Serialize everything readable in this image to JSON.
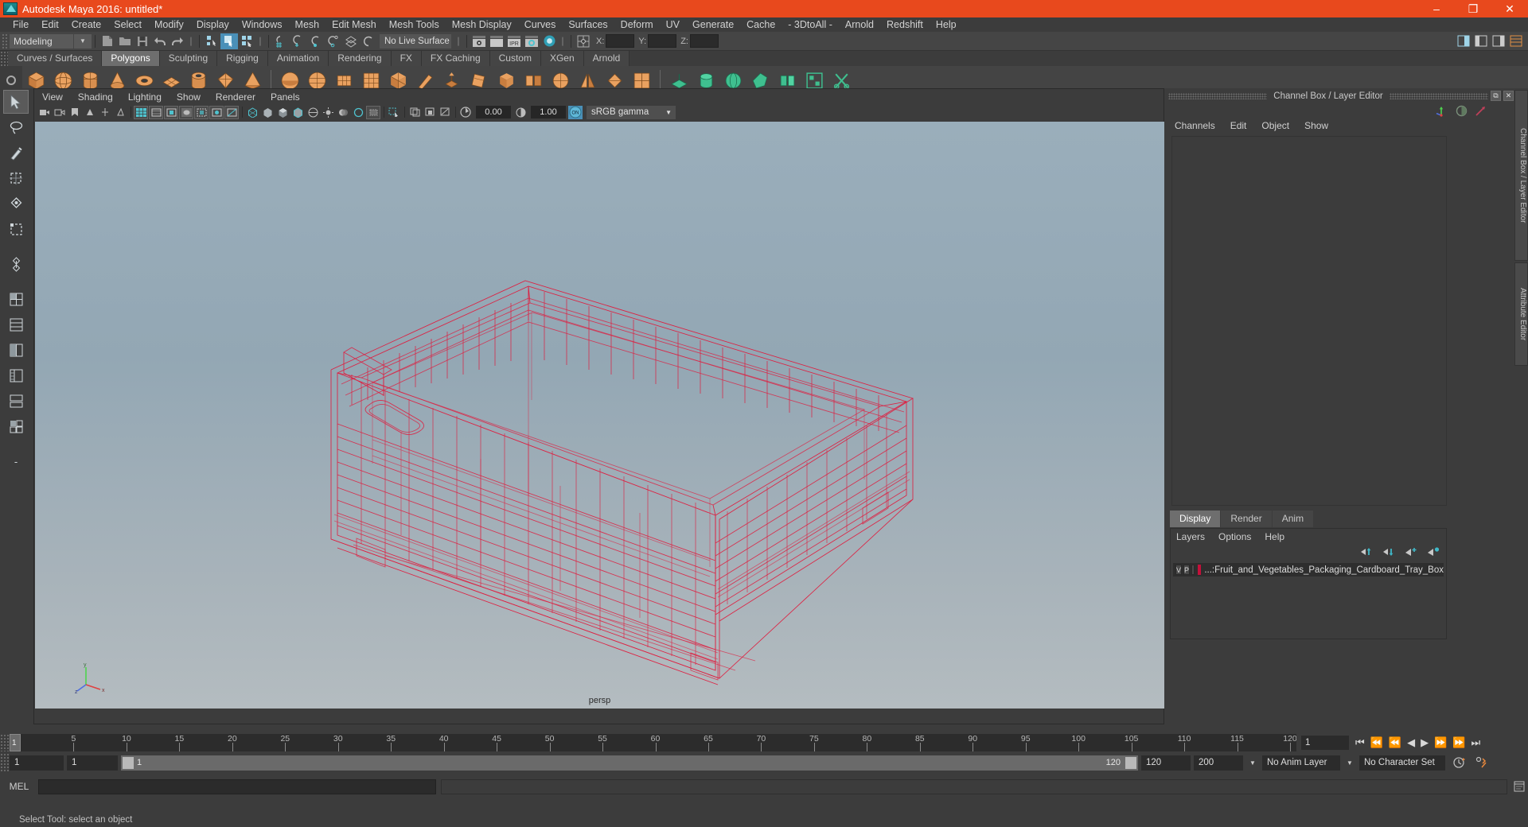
{
  "titlebar": {
    "title": "Autodesk Maya 2016: untitled*",
    "logo_icon": "maya-logo-icon",
    "minimize": "–",
    "maximize": "❐",
    "close": "✕"
  },
  "menubar": {
    "items": [
      "File",
      "Edit",
      "Create",
      "Select",
      "Modify",
      "Display",
      "Windows",
      "Mesh",
      "Edit Mesh",
      "Mesh Tools",
      "Mesh Display",
      "Curves",
      "Surfaces",
      "Deform",
      "UV",
      "Generate",
      "Cache",
      "- 3DtoAll -",
      "Arnold",
      "Redshift",
      "Help"
    ]
  },
  "statusline": {
    "menu_set": "Modeling",
    "live_surface": "No Live Surface",
    "coord_x_label": "X:",
    "coord_y_label": "Y:",
    "coord_z_label": "Z:",
    "coord_x_value": "",
    "coord_y_value": "",
    "coord_z_value": "",
    "ipr_label": "IPR"
  },
  "shelf": {
    "tabs": [
      "Curves / Surfaces",
      "Polygons",
      "Sculpting",
      "Rigging",
      "Animation",
      "Rendering",
      "FX",
      "FX Caching",
      "Custom",
      "XGen",
      "Arnold"
    ],
    "active_tab": "Polygons"
  },
  "viewport": {
    "panel_menus": [
      "View",
      "Shading",
      "Lighting",
      "Show",
      "Renderer",
      "Panels"
    ],
    "exposure_value": "0.00",
    "gamma_value": "1.00",
    "color_profile": "sRGB gamma",
    "view_label": "persp",
    "on_badge": "ON",
    "axis_labels": {
      "y": "y",
      "x": "x",
      "z": "z"
    }
  },
  "channel_box": {
    "title": "Channel Box / Layer Editor",
    "restore_icon": "restore-panel-icon",
    "close_icon": "close-panel-icon",
    "menus": [
      "Channels",
      "Edit",
      "Object",
      "Show"
    ]
  },
  "layer_editor": {
    "tabs": [
      "Display",
      "Render",
      "Anim"
    ],
    "active_tab": "Display",
    "menus": [
      "Layers",
      "Options",
      "Help"
    ],
    "layers": [
      {
        "visibility": "V",
        "playback": "P",
        "color": "#c4103a",
        "name": "...:Fruit_and_Vegetables_Packaging_Cardboard_Tray_Box"
      }
    ]
  },
  "side_tabs": [
    "Channel Box / Layer Editor",
    "Attribute Editor"
  ],
  "timeline": {
    "ticks": [
      5,
      10,
      15,
      20,
      25,
      30,
      35,
      40,
      45,
      50,
      55,
      60,
      65,
      70,
      75,
      80,
      85,
      90,
      95,
      100,
      105,
      110,
      115,
      120
    ],
    "start": 1,
    "end": 120,
    "current_frame_marker": "1",
    "current_frame_field": "1"
  },
  "range": {
    "range_start": "1",
    "anim_start": "1",
    "slider_left_label": "1",
    "slider_right_label": "120",
    "anim_end": "120",
    "range_end": "200",
    "anim_layer": "No Anim Layer",
    "character_set": "No Character Set"
  },
  "mel": {
    "label": "MEL",
    "command": ""
  },
  "helpline": {
    "text": "Select Tool: select an object"
  },
  "colors": {
    "title_bar": "#e8491d",
    "accent_blue": "#4a90b8",
    "wireframe_red": "#e01a3c",
    "shelf_orange": "#e08e45"
  },
  "model": {
    "wireframe_color": "#e01a3c",
    "name": "Fruit_and_Vegetables_Packaging_Cardboard_Tray_Box"
  }
}
